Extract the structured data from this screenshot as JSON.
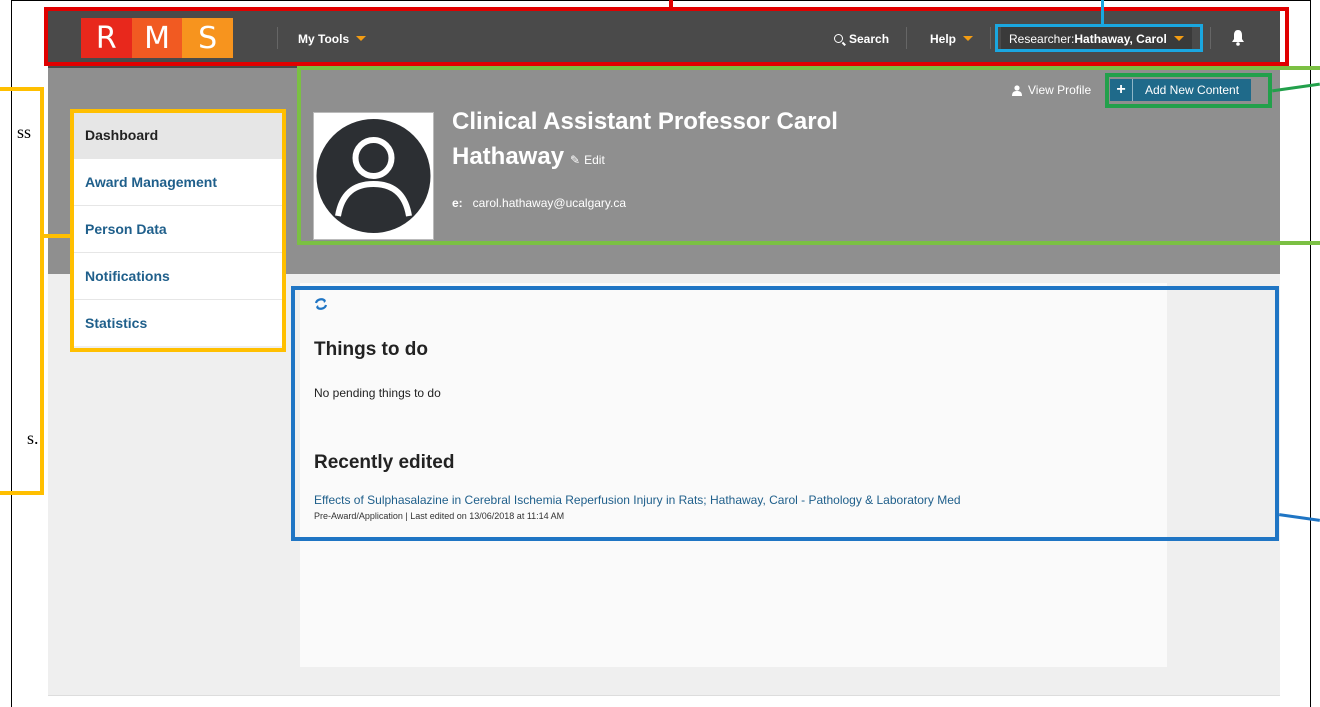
{
  "topbar": {
    "logo_letters": [
      "R",
      "M",
      "S"
    ],
    "my_tools_label": "My Tools",
    "search_label": "Search",
    "help_label": "Help",
    "researcher_prefix": "Researcher: ",
    "researcher_name": "Hathaway, Carol",
    "icons": [
      "search-icon",
      "bell-icon",
      "caret-down-icon"
    ]
  },
  "sidebar": {
    "items": [
      {
        "label": "Dashboard",
        "active": true
      },
      {
        "label": "Award Management"
      },
      {
        "label": "Person Data"
      },
      {
        "label": "Notifications"
      },
      {
        "label": "Statistics"
      }
    ]
  },
  "profile": {
    "view_profile_label": "View Profile",
    "add_content_label": "Add New Content",
    "title_line1": "Clinical Assistant Professor Carol",
    "title_line2": "Hathaway",
    "edit_label": "Edit",
    "email_prefix": "e:",
    "email": "carol.hathaway@ucalgary.ca"
  },
  "dashboard": {
    "things_heading": "Things to do",
    "things_empty": "No pending things to do",
    "recent_heading": "Recently edited",
    "recent_items": [
      {
        "title": "Effects of Sulphasalazine in Cerebral Ischemia Reperfusion Injury in Rats; Hathaway, Carol - Pathology & Laboratory Med",
        "meta": "Pre-Award/Application | Last edited on 13/06/2018 at 11:14 AM"
      }
    ]
  },
  "side_notes": {
    "fragment_ss": "ss",
    "fragment_s": "s."
  },
  "colors": {
    "topbar": "#4a4a4a",
    "accent_orange": "#f39c12",
    "link_blue": "#1f5f8b",
    "button_teal": "#1f6a8a",
    "annotation_red": "#e00000",
    "annotation_cyan": "#1aa7e0",
    "annotation_yellow": "#ffbf00",
    "annotation_green": "#7bc043",
    "annotation_blue": "#1f75c4"
  }
}
